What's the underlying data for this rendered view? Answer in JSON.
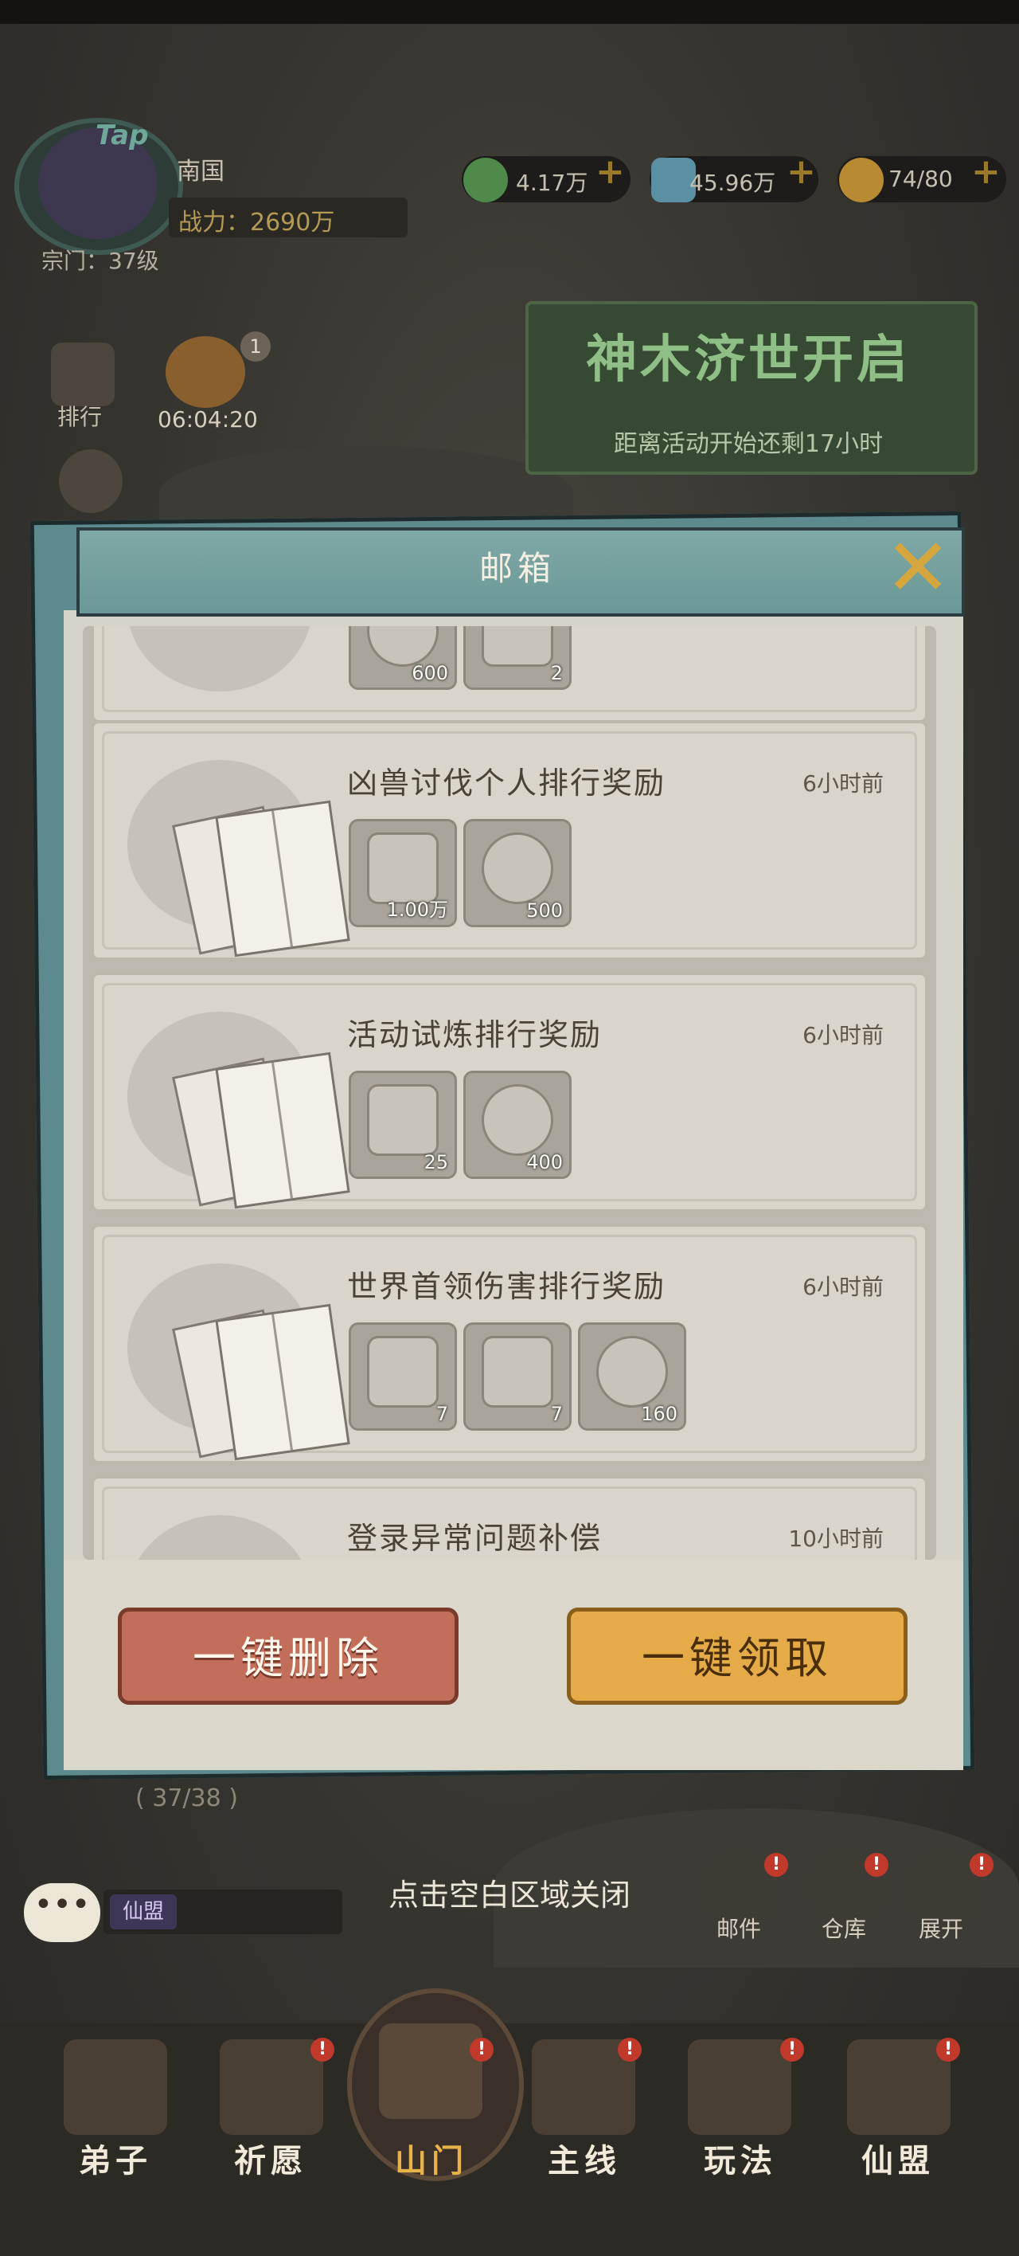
{
  "player": {
    "name": "南国",
    "power": "战力：2690万",
    "sect": "宗门：37级",
    "tap_badge": "Tap"
  },
  "resources": [
    {
      "icon": "jade-coin-icon",
      "value": "4.17万"
    },
    {
      "icon": "spirit-stone-icon",
      "value": "45.96万"
    },
    {
      "icon": "stamina-gourd-icon",
      "value": "74/80"
    }
  ],
  "side": {
    "ranking_label": "排行",
    "gift_timer": "06:04:20",
    "gift_badge": "1"
  },
  "event": {
    "title": "神木济世开启",
    "subtitle": "距离活动开始还剩17小时"
  },
  "modal": {
    "title": "邮箱",
    "mails": [
      {
        "title": "凶兽讨伐个人排行奖励",
        "time": "6小时前",
        "items": [
          {
            "icon": "spirit-stone-icon",
            "count": "1.00万"
          },
          {
            "icon": "copper-coin-icon",
            "count": "500"
          }
        ]
      },
      {
        "title": "活动试炼排行奖励",
        "time": "6小时前",
        "items": [
          {
            "icon": "token-box-icon",
            "count": "25"
          },
          {
            "icon": "copper-coin-icon",
            "count": "400"
          }
        ]
      },
      {
        "title": "世界首领伤害排行奖励",
        "time": "6小时前",
        "items": [
          {
            "icon": "scroll-tablet-icon",
            "count": "7"
          },
          {
            "icon": "treasure-chest-icon",
            "count": "7"
          },
          {
            "icon": "ore-icon",
            "count": "160"
          }
        ]
      },
      {
        "title": "登录异常问题补偿",
        "time": "10小时前"
      }
    ],
    "partial_top_items": [
      {
        "count": "600"
      },
      {
        "count": "2"
      }
    ],
    "delete_all": "一键删除",
    "claim_all": "一键领取"
  },
  "hud": {
    "close_hint": "点击空白区域关闭",
    "chat_tag": "仙盟",
    "mail": "邮件",
    "warehouse": "仓库",
    "expand": "展开",
    "alert": "!",
    "progress_text": "( 37/38 )"
  },
  "nav": [
    "弟子",
    "祈愿",
    "山门",
    "主线",
    "玩法",
    "仙盟"
  ],
  "colors": {
    "accent_gold": "#e4ab48",
    "delete_red": "#c26e5b",
    "modal_teal": "#6a9896",
    "alert_red": "#c0392b"
  }
}
